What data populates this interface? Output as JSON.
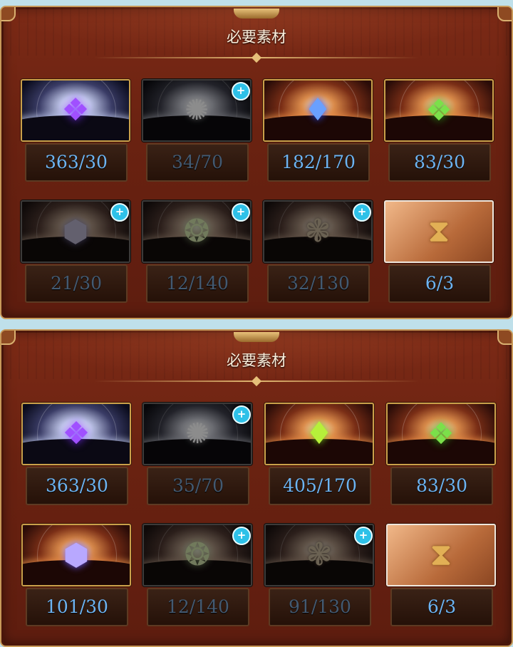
{
  "panels": [
    {
      "title": "必要素材",
      "items": [
        {
          "icon": "purple-crystal-icon",
          "count": "363/30",
          "zoom": false,
          "dim": false
        },
        {
          "icon": "spirit-orb-icon",
          "count": "34/70",
          "zoom": true,
          "dim": true
        },
        {
          "icon": "blue-prism-icon",
          "count": "182/170",
          "zoom": false,
          "dim": false
        },
        {
          "icon": "green-crystal-icon",
          "count": "83/30",
          "zoom": false,
          "dim": false
        },
        {
          "icon": "hexagon-shield-icon",
          "count": "21/30",
          "zoom": true,
          "dim": true
        },
        {
          "icon": "ornate-medallion-icon",
          "count": "12/140",
          "zoom": true,
          "dim": true
        },
        {
          "icon": "winged-sigil-icon",
          "count": "32/130",
          "zoom": true,
          "dim": true
        },
        {
          "icon": "hourglass-icon",
          "count": "6/3",
          "zoom": false,
          "dim": false
        }
      ]
    },
    {
      "title": "必要素材",
      "items": [
        {
          "icon": "purple-crystal-icon",
          "count": "363/30",
          "zoom": false,
          "dim": false
        },
        {
          "icon": "spirit-orb-icon",
          "count": "35/70",
          "zoom": true,
          "dim": true
        },
        {
          "icon": "green-prism-icon",
          "count": "405/170",
          "zoom": false,
          "dim": false
        },
        {
          "icon": "green-crystal-icon",
          "count": "83/30",
          "zoom": false,
          "dim": false
        },
        {
          "icon": "hexagon-shield-icon",
          "count": "101/30",
          "zoom": false,
          "dim": false
        },
        {
          "icon": "ornate-medallion-icon",
          "count": "12/140",
          "zoom": true,
          "dim": true
        },
        {
          "icon": "winged-sigil-icon",
          "count": "91/130",
          "zoom": true,
          "dim": true
        },
        {
          "icon": "hourglass-icon",
          "count": "6/3",
          "zoom": false,
          "dim": false
        }
      ]
    }
  ],
  "zoom_symbol": "+",
  "colors": {
    "count_active": "#6db4f2",
    "count_insufficient": "#435a72",
    "panel_background": "#6a2211",
    "icon_frame_gold": "#caa04a",
    "zoom_button": "#2ec1e8"
  }
}
